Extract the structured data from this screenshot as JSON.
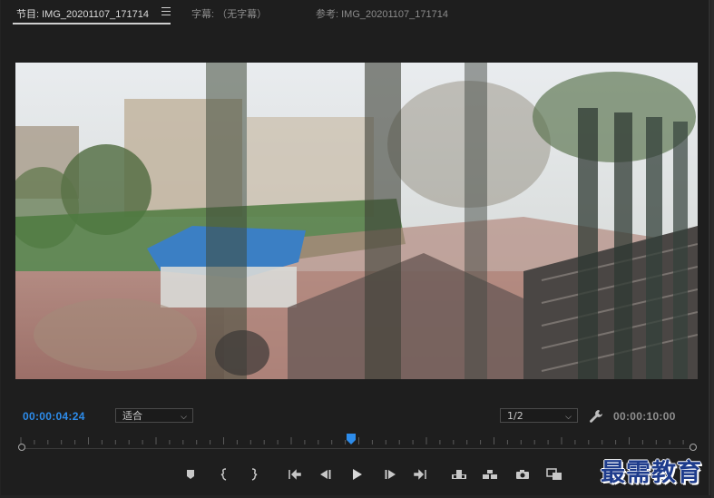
{
  "tabs": [
    {
      "label": "节目: IMG_20201107_171714",
      "active": true
    },
    {
      "label": "字幕: （无字幕）",
      "active": false
    },
    {
      "label": "参考: IMG_20201107_171714",
      "active": false
    }
  ],
  "timecode": {
    "current": "00:00:04:24",
    "duration": "00:00:10:00"
  },
  "fit_select": {
    "value": "适合"
  },
  "resolution_select": {
    "value": "1/2"
  },
  "playhead_fraction": 0.49,
  "watermark": "最需教育",
  "icons": {
    "panel_menu": "hamburger-menu-icon",
    "settings": "wrench-icon",
    "transport": [
      "add-marker-icon",
      "mark-in-icon",
      "mark-out-icon",
      "go-to-in-icon",
      "step-back-icon",
      "play-icon",
      "step-forward-icon",
      "go-to-out-icon",
      "lift-icon",
      "extract-icon",
      "export-frame-icon",
      "compare-view-icon"
    ]
  },
  "colors": {
    "accent": "#2d8ceb",
    "panel_bg": "#1e1e1e"
  }
}
